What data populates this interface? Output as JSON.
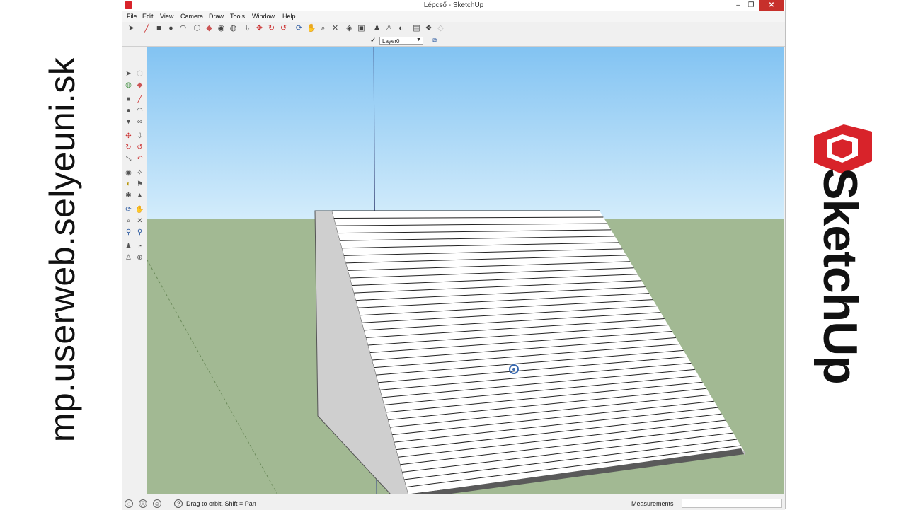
{
  "side_url": "mp.userweb.selyeuni.sk",
  "brand": {
    "wordmark": "SketchUp",
    "logo_color": "#d8232a"
  },
  "window": {
    "title": "Lépcső - SketchUp"
  },
  "menus": [
    "File",
    "Edit",
    "View",
    "Camera",
    "Draw",
    "Tools",
    "Window",
    "Help"
  ],
  "layer": {
    "name": "Layer0"
  },
  "status": {
    "hint": "Drag to orbit.  Shift = Pan",
    "measurements_label": "Measurements",
    "measurements_value": ""
  },
  "colors": {
    "sky_top": "#82c3f2",
    "sky_bottom": "#d3ecfb",
    "ground": "#a2b993",
    "step": "#ffffff",
    "side": "#cfcfcf"
  }
}
